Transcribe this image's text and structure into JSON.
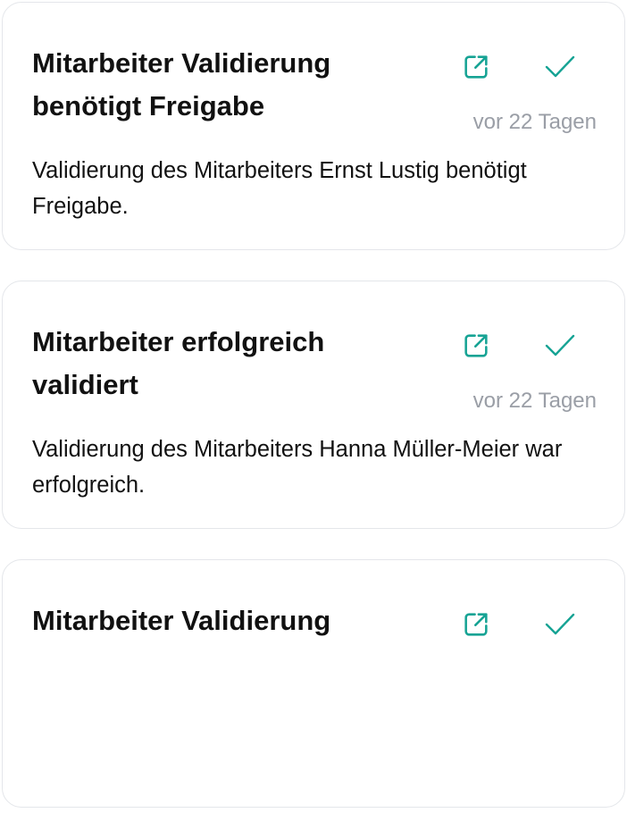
{
  "colors": {
    "accent": "#16a394",
    "muted_text": "#9a9ea6",
    "card_border": "#e4e6ea"
  },
  "icons": {
    "open": "external-link-icon",
    "confirm": "checkmark-icon"
  },
  "notifications": [
    {
      "title": "Mitarbeiter Validierung benötigt Freigabe",
      "time": "vor 22 Tagen",
      "message": "Validierung des Mitarbeiters Ernst Lustig benötigt Freigabe."
    },
    {
      "title": "Mitarbeiter erfolgreich validiert",
      "time": "vor 22 Tagen",
      "message": "Validierung des Mitarbeiters Hanna Müller-Meier war erfolgreich."
    },
    {
      "title": "Mitarbeiter Validierung",
      "time": "",
      "message": ""
    }
  ]
}
